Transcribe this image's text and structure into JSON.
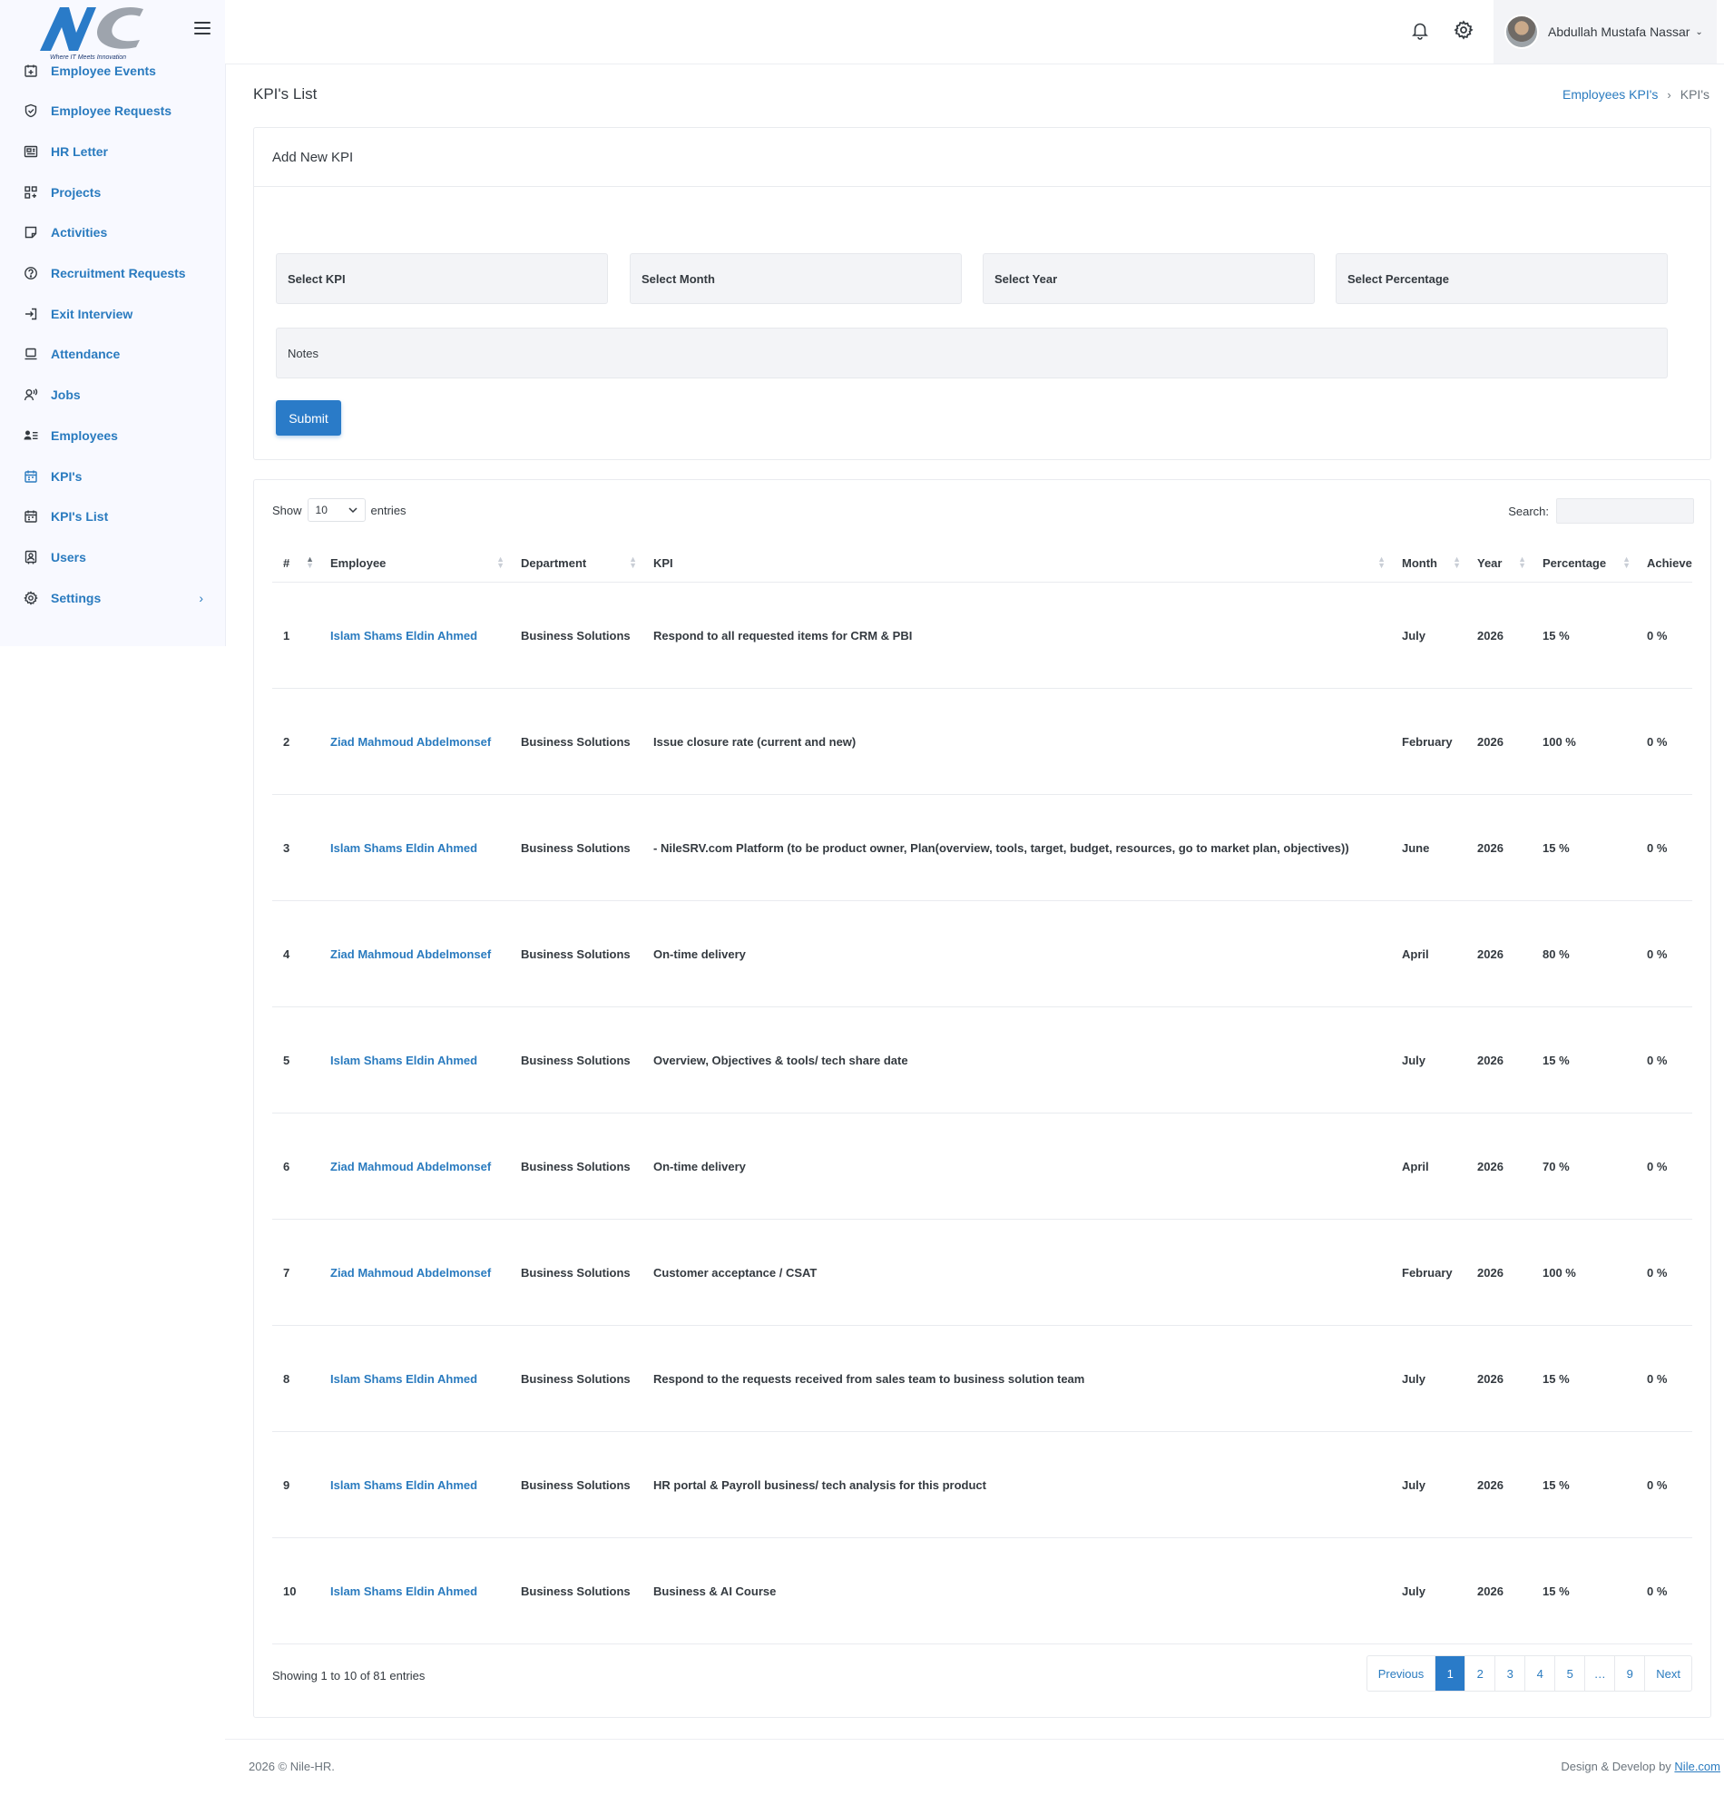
{
  "brand": {
    "logo_text": "NC",
    "tagline": "Where IT Meets Innovation"
  },
  "sidebar": {
    "items": [
      {
        "label": "Employee Events",
        "icon": "calendar-plus-icon"
      },
      {
        "label": "Employee Requests",
        "icon": "shield-check-icon"
      },
      {
        "label": "HR Letter",
        "icon": "newspaper-icon"
      },
      {
        "label": "Projects",
        "icon": "grid-icon"
      },
      {
        "label": "Activities",
        "icon": "note-icon"
      },
      {
        "label": "Recruitment Requests",
        "icon": "question-circle-icon"
      },
      {
        "label": "Exit Interview",
        "icon": "exit-icon"
      },
      {
        "label": "Attendance",
        "icon": "laptop-icon"
      },
      {
        "label": "Jobs",
        "icon": "user-voice-icon"
      },
      {
        "label": "Employees",
        "icon": "user-list-icon"
      },
      {
        "label": "KPI's",
        "icon": "calendar-icon"
      },
      {
        "label": "KPI's List",
        "icon": "calendar-icon"
      },
      {
        "label": "Users",
        "icon": "user-badge-icon"
      },
      {
        "label": "Settings",
        "icon": "gear-icon"
      }
    ],
    "settings_chevron": "›"
  },
  "topbar": {
    "user_name": "Abdullah Mustafa Nassar",
    "caret": "⌄"
  },
  "page": {
    "title": "KPI's List"
  },
  "breadcrumb": {
    "parent": "Employees KPI's",
    "sep": "›",
    "current": "KPI's"
  },
  "form": {
    "heading": "Add New KPI",
    "select_kpi": "Select KPI",
    "select_month": "Select Month",
    "select_year": "Select Year",
    "select_percentage": "Select Percentage",
    "notes": "Notes",
    "submit": "Submit"
  },
  "table_controls": {
    "show": "Show",
    "length_value": "10",
    "entries": "entries",
    "search_label": "Search:"
  },
  "table": {
    "headers": {
      "num": "#",
      "employee": "Employee",
      "department": "Department",
      "kpi": "KPI",
      "month": "Month",
      "year": "Year",
      "percentage": "Percentage",
      "achieve": "Achieve"
    },
    "rows": [
      {
        "num": "1",
        "employee": "Islam Shams Eldin Ahmed",
        "department": "Business Solutions",
        "kpi": "Respond to all requested items for CRM & PBI",
        "month": "July",
        "year": "2026",
        "percentage": "15 %",
        "achieve": "0 %"
      },
      {
        "num": "2",
        "employee": "Ziad Mahmoud Abdelmonsef",
        "department": "Business Solutions",
        "kpi": "Issue closure rate (current and new)",
        "month": "February",
        "year": "2026",
        "percentage": "100 %",
        "achieve": "0 %"
      },
      {
        "num": "3",
        "employee": "Islam Shams Eldin Ahmed",
        "department": "Business Solutions",
        "kpi": "- NileSRV.com Platform (to be product owner, Plan(overview, tools, target, budget, resources, go to market plan, objectives))",
        "month": "June",
        "year": "2026",
        "percentage": "15 %",
        "achieve": "0 %"
      },
      {
        "num": "4",
        "employee": "Ziad Mahmoud Abdelmonsef",
        "department": "Business Solutions",
        "kpi": "On-time delivery",
        "month": "April",
        "year": "2026",
        "percentage": "80 %",
        "achieve": "0 %"
      },
      {
        "num": "5",
        "employee": "Islam Shams Eldin Ahmed",
        "department": "Business Solutions",
        "kpi": "Overview, Objectives & tools/ tech share date",
        "month": "July",
        "year": "2026",
        "percentage": "15 %",
        "achieve": "0 %"
      },
      {
        "num": "6",
        "employee": "Ziad Mahmoud Abdelmonsef",
        "department": "Business Solutions",
        "kpi": "On-time delivery",
        "month": "April",
        "year": "2026",
        "percentage": "70 %",
        "achieve": "0 %"
      },
      {
        "num": "7",
        "employee": "Ziad Mahmoud Abdelmonsef",
        "department": "Business Solutions",
        "kpi": "Customer acceptance / CSAT",
        "month": "February",
        "year": "2026",
        "percentage": "100 %",
        "achieve": "0 %"
      },
      {
        "num": "8",
        "employee": "Islam Shams Eldin Ahmed",
        "department": "Business Solutions",
        "kpi": "Respond to the requests received from sales team to business solution team",
        "month": "July",
        "year": "2026",
        "percentage": "15 %",
        "achieve": "0 %"
      },
      {
        "num": "9",
        "employee": "Islam Shams Eldin Ahmed",
        "department": "Business Solutions",
        "kpi": "HR portal & Payroll business/ tech analysis for this product",
        "month": "July",
        "year": "2026",
        "percentage": "15 %",
        "achieve": "0 %"
      },
      {
        "num": "10",
        "employee": "Islam Shams Eldin Ahmed",
        "department": "Business Solutions",
        "kpi": "Business & AI Course",
        "month": "July",
        "year": "2026",
        "percentage": "15 %",
        "achieve": "0 %"
      }
    ],
    "info": "Showing 1 to 10 of 81 entries"
  },
  "pagination": {
    "previous": "Previous",
    "pages": [
      "1",
      "2",
      "3",
      "4",
      "5",
      "…",
      "9"
    ],
    "next": "Next",
    "active": "1"
  },
  "footer": {
    "left": "2026 © Nile-HR.",
    "right_prefix": "Design & Develop by ",
    "right_link": "Nile.com"
  },
  "colors": {
    "accent": "#2a7bc8",
    "link": "#2a7bbf",
    "sidebar_bg": "#f8f9ff",
    "field_bg": "#f3f4f7"
  }
}
